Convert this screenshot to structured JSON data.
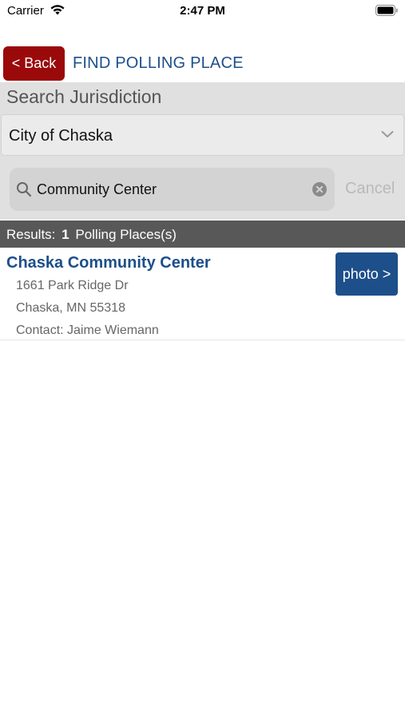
{
  "status_bar": {
    "carrier": "Carrier",
    "time": "2:47 PM",
    "icons": [
      "wifi-icon",
      "battery-icon"
    ]
  },
  "nav": {
    "back_label": "< Back",
    "title": "FIND POLLING PLACE"
  },
  "jurisdiction": {
    "label": "Search Jurisdiction",
    "selected": "City of Chaska"
  },
  "search": {
    "value": "Community Center",
    "cancel_label": "Cancel"
  },
  "results": {
    "prefix": "Results:",
    "count": "1",
    "suffix": "Polling Places(s)"
  },
  "items": [
    {
      "name": "Chaska Community Center",
      "address_line1": "1661 Park Ridge Dr",
      "address_line2": "Chaska, MN 55318",
      "contact": "Contact: Jaime Wiemann",
      "photo_label": "photo >"
    }
  ],
  "colors": {
    "brand_blue": "#1d4f8a",
    "back_red": "#9a0a0a",
    "results_bar": "#585858",
    "section_bg": "#e0e0e0"
  }
}
